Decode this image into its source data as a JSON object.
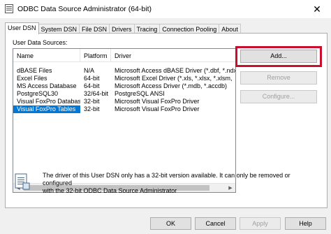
{
  "window": {
    "title": "ODBC Data Source Administrator (64-bit)"
  },
  "tabs": [
    {
      "label": "User DSN",
      "active": true
    },
    {
      "label": "System DSN"
    },
    {
      "label": "File DSN"
    },
    {
      "label": "Drivers"
    },
    {
      "label": "Tracing"
    },
    {
      "label": "Connection Pooling"
    },
    {
      "label": "About"
    }
  ],
  "data_sources": {
    "group_label": "User Data Sources:",
    "columns": [
      "Name",
      "Platform",
      "Driver"
    ],
    "rows": [
      {
        "name": "dBASE Files",
        "platform": "N/A",
        "driver": "Microsoft Access dBASE Driver (*.dbf, *.ndx,"
      },
      {
        "name": "Excel Files",
        "platform": "64-bit",
        "driver": "Microsoft Excel Driver (*.xls, *.xlsx, *.xlsm,"
      },
      {
        "name": "MS Access Database",
        "platform": "64-bit",
        "driver": "Microsoft Access Driver (*.mdb, *.accdb)"
      },
      {
        "name": "PostgreSQL30",
        "platform": "32/64-bit",
        "driver": "PostgreSQL ANSI"
      },
      {
        "name": "Visual FoxPro Database",
        "platform": "32-bit",
        "driver": "Microsoft Visual FoxPro Driver"
      },
      {
        "name": "Visual FoxPro Tables",
        "platform": "32-bit",
        "driver": "Microsoft Visual FoxPro Driver",
        "selected": true
      }
    ]
  },
  "side_buttons": {
    "add": "Add...",
    "remove": "Remove",
    "configure": "Configure..."
  },
  "info": {
    "icon": "data-source-icon",
    "text_line1": "The driver of this User DSN only has a 32-bit version available. It can only be removed or configured",
    "text_line2": "with the 32-bit ODBC Data Source Administrator"
  },
  "footer_buttons": {
    "ok": "OK",
    "cancel": "Cancel",
    "apply": "Apply",
    "help": "Help"
  },
  "colors": {
    "selection": "#0078d7",
    "highlight_border": "#c8102e"
  }
}
